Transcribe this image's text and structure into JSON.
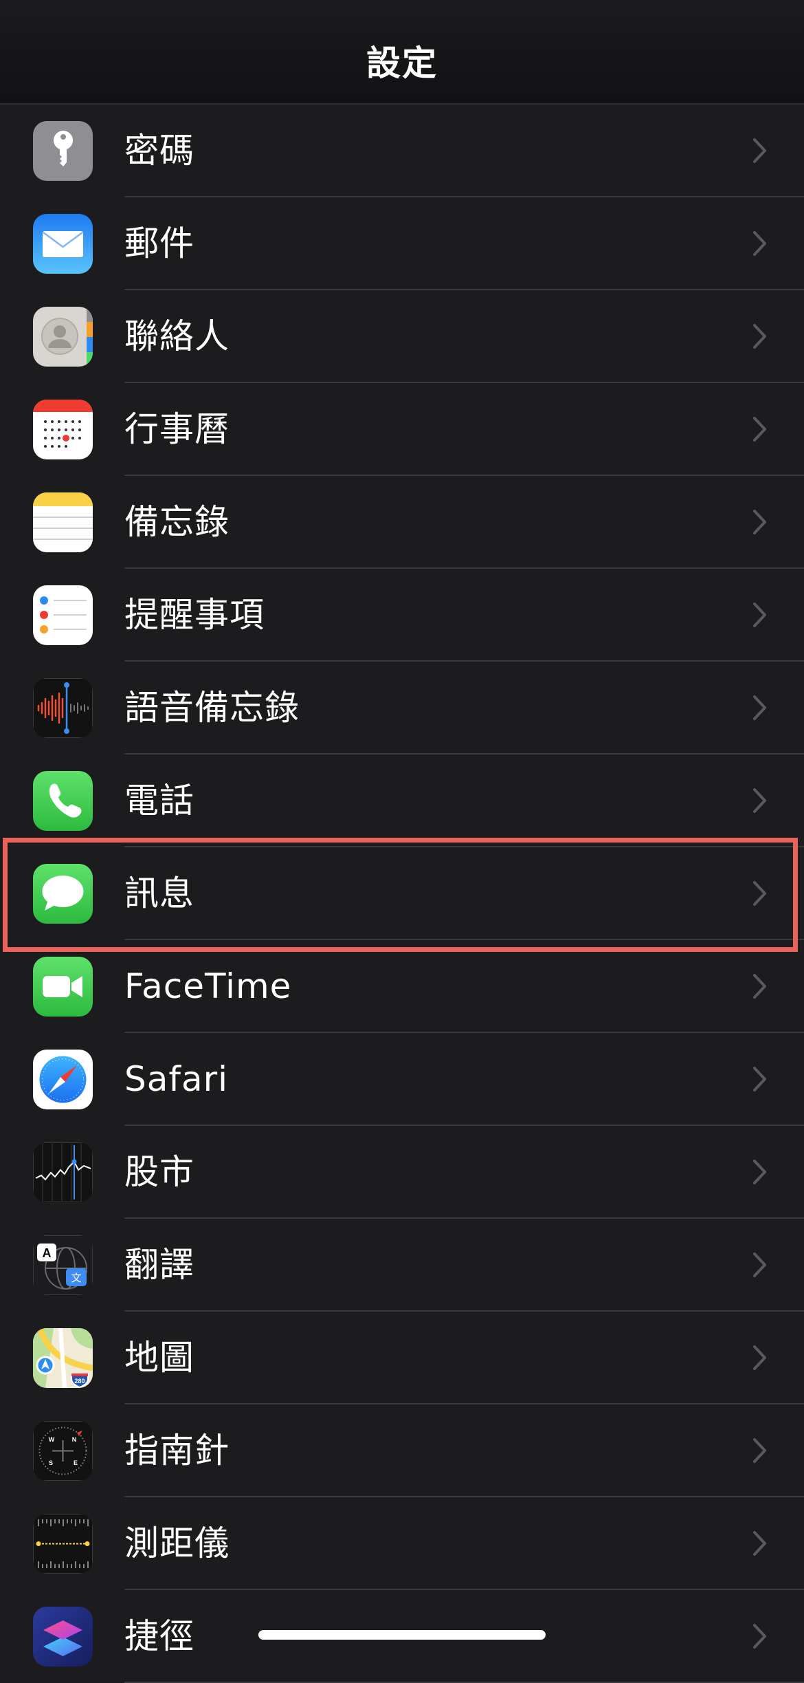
{
  "header": {
    "title": "設定"
  },
  "items": [
    {
      "label": "密碼",
      "icon": "key-icon"
    },
    {
      "label": "郵件",
      "icon": "mail-icon"
    },
    {
      "label": "聯絡人",
      "icon": "contacts-icon"
    },
    {
      "label": "行事曆",
      "icon": "calendar-icon"
    },
    {
      "label": "備忘錄",
      "icon": "notes-icon"
    },
    {
      "label": "提醒事項",
      "icon": "reminders-icon"
    },
    {
      "label": "語音備忘錄",
      "icon": "voice-memos-icon"
    },
    {
      "label": "電話",
      "icon": "phone-icon"
    },
    {
      "label": "訊息",
      "icon": "messages-icon"
    },
    {
      "label": "FaceTime",
      "icon": "facetime-icon"
    },
    {
      "label": "Safari",
      "icon": "safari-icon"
    },
    {
      "label": "股市",
      "icon": "stocks-icon"
    },
    {
      "label": "翻譯",
      "icon": "translate-icon"
    },
    {
      "label": "地圖",
      "icon": "maps-icon"
    },
    {
      "label": "指南針",
      "icon": "compass-icon"
    },
    {
      "label": "測距儀",
      "icon": "measure-icon"
    },
    {
      "label": "捷徑",
      "icon": "shortcuts-icon"
    }
  ],
  "icon_text": {
    "translate_a": "A",
    "translate_zh": "文",
    "maps_shield": "280",
    "compass_n": "N",
    "compass_e": "E",
    "compass_s": "S",
    "compass_w": "W"
  },
  "colors": {
    "background": "#1c1c1e",
    "separator": "#38383a",
    "chevron": "#5a5a5e",
    "highlight": "#e9635a"
  }
}
